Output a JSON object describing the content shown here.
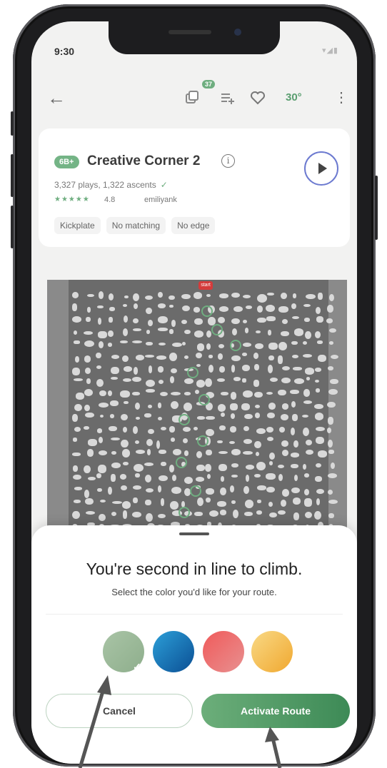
{
  "status": {
    "time": "9:30",
    "icons": "▾◢▮"
  },
  "toolbar": {
    "back_icon": "←",
    "badge": "37",
    "angle": "30°",
    "more_icon": "⋮"
  },
  "climb": {
    "grade": "6B+",
    "name": "Creative Corner 2",
    "stats": "3,327 plays, 1,322 ascents",
    "stars": "★★★★★",
    "rating": "4.8",
    "setter": "emiliyank",
    "tags": [
      "Kickplate",
      "No matching",
      "No edge"
    ]
  },
  "board": {
    "start_label": "start"
  },
  "sheet": {
    "title": "You're second in line to climb.",
    "subtitle": "Select the color you'd like for your route.",
    "colors": [
      "#9fbc9c",
      "#1a76b8",
      "#ec6b6b",
      "#f5c55a"
    ],
    "selected_color_index": 0,
    "cancel_label": "Cancel",
    "activate_label": "Activate Route"
  }
}
